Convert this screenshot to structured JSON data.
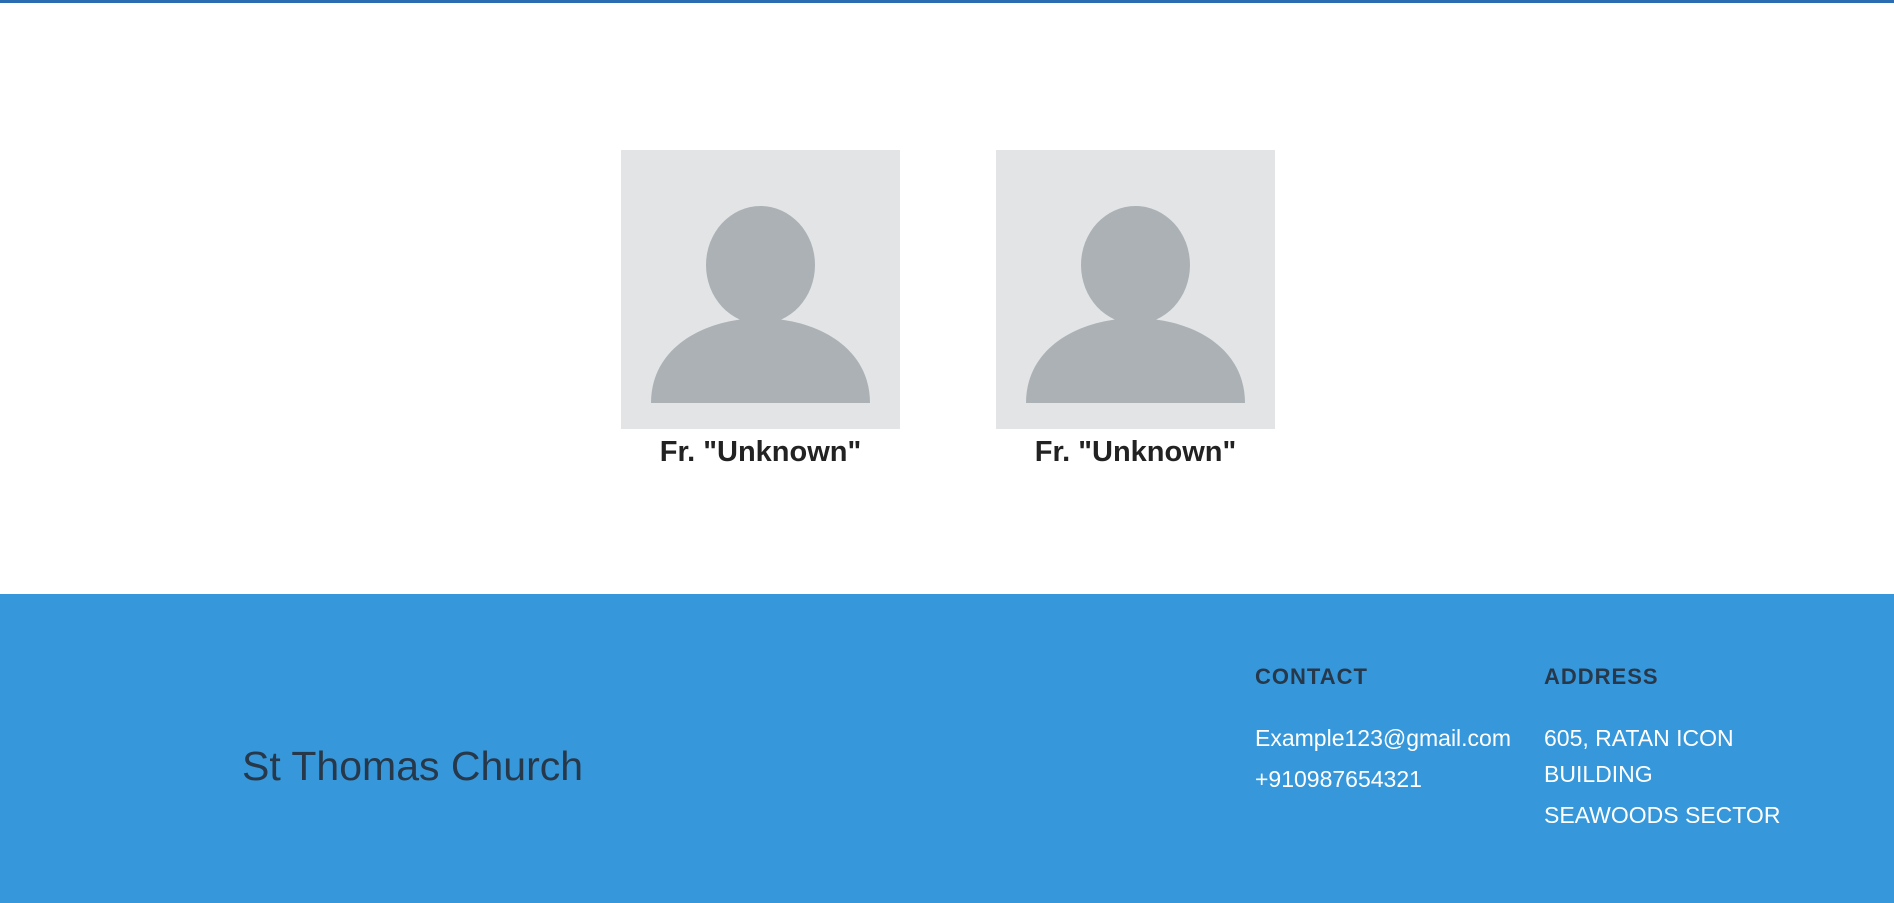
{
  "clergy": {
    "members": [
      {
        "name": "Fr. \"Unknown\"",
        "photo_icon": "default-avatar-icon"
      },
      {
        "name": "Fr. \"Unknown\"",
        "photo_icon": "default-avatar-icon"
      }
    ]
  },
  "footer": {
    "brand": "St Thomas Church",
    "contact": {
      "heading": "CONTACT",
      "email": "Example123@gmail.com",
      "phone": "+910987654321"
    },
    "address": {
      "heading": "ADDRESS",
      "line1": "605, RATAN ICON BUILDING",
      "line2": "SEAWOODS SECTOR"
    }
  },
  "colors": {
    "top_bar": "#2b6cb0",
    "footer_bg": "#3698db",
    "footer_heading": "#27384a",
    "footer_text": "#ffffff",
    "avatar_bg": "#e3e4e6",
    "avatar_fg": "#acb1b5"
  }
}
